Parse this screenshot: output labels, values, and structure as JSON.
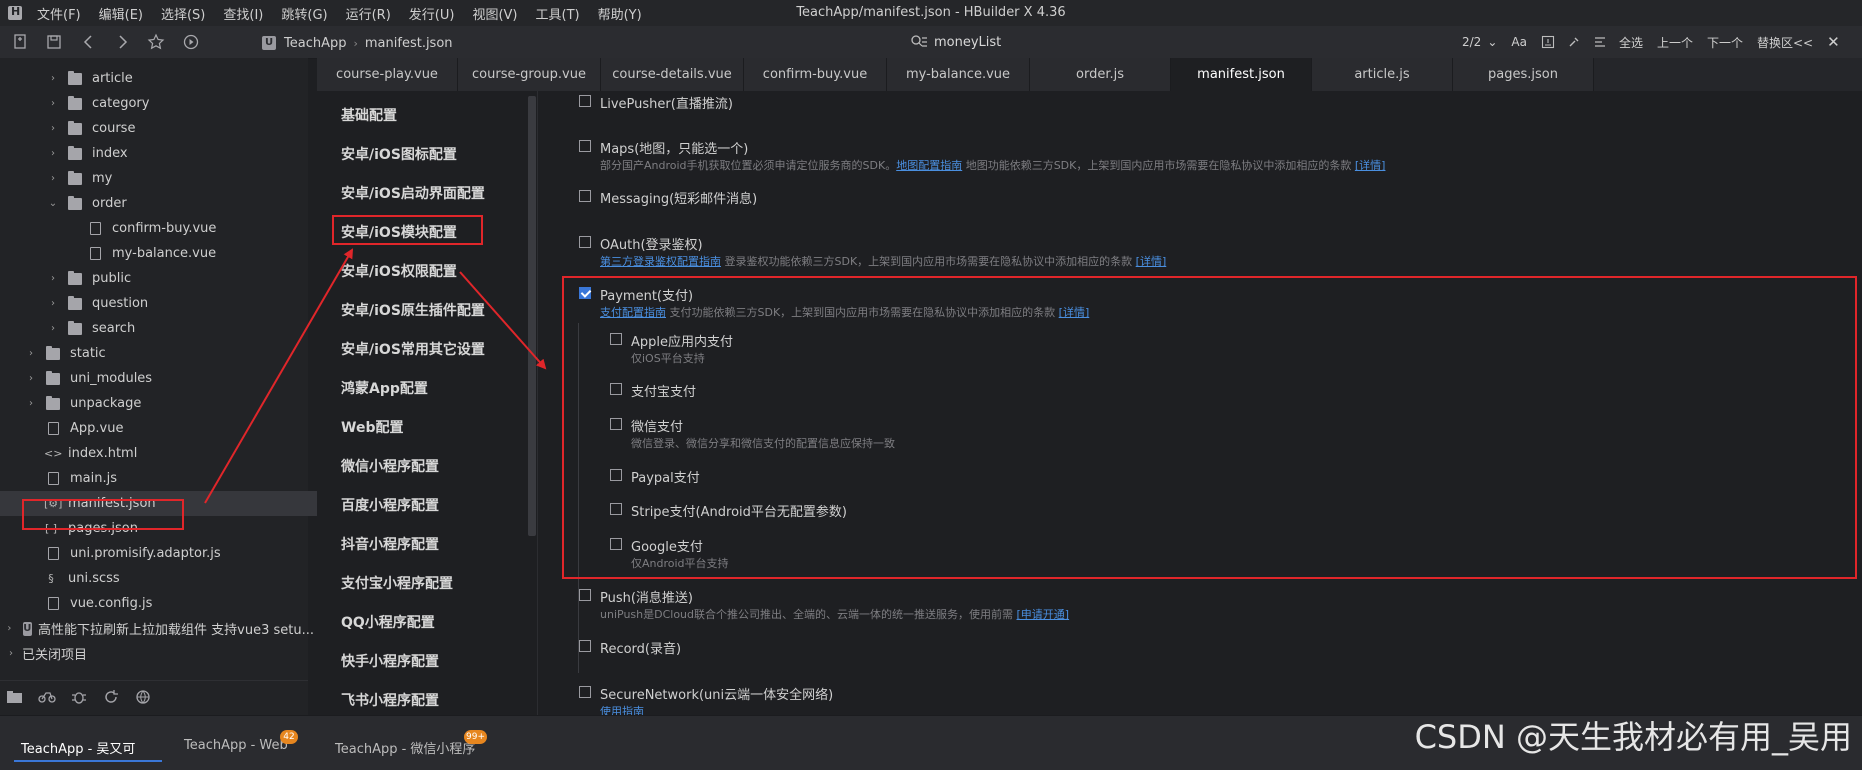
{
  "menubar": {
    "items": [
      "文件(F)",
      "编辑(E)",
      "选择(S)",
      "查找(I)",
      "跳转(G)",
      "运行(R)",
      "发行(U)",
      "视图(V)",
      "工具(T)",
      "帮助(Y)"
    ],
    "title": "TeachApp/manifest.json - HBuilder X 4.36"
  },
  "toolbar": {
    "breadcrumb": [
      "TeachApp",
      "manifest.json"
    ],
    "project_badge": "U",
    "search_value": "moneyList",
    "find": {
      "count": "2/2",
      "case_label": "Aa",
      "select_all": "全选",
      "prev": "上一个",
      "next": "下一个",
      "replace": "替换区<<"
    }
  },
  "sidebar": {
    "items": [
      {
        "label": "article",
        "kind": "folder",
        "expand": "›"
      },
      {
        "label": "category",
        "kind": "folder",
        "expand": "›"
      },
      {
        "label": "course",
        "kind": "folder",
        "expand": "›"
      },
      {
        "label": "index",
        "kind": "folder",
        "expand": "›"
      },
      {
        "label": "my",
        "kind": "folder",
        "expand": "›"
      },
      {
        "label": "order",
        "kind": "folder",
        "expand": "⌄"
      },
      {
        "label": "confirm-buy.vue",
        "kind": "vfile"
      },
      {
        "label": "my-balance.vue",
        "kind": "vfile"
      },
      {
        "label": "public",
        "kind": "folder",
        "expand": "›"
      },
      {
        "label": "question",
        "kind": "folder",
        "expand": "›"
      },
      {
        "label": "search",
        "kind": "folder",
        "expand": "›"
      },
      {
        "label": "static",
        "kind": "folder",
        "expand": "›"
      },
      {
        "label": "uni_modules",
        "kind": "folder",
        "expand": "›"
      },
      {
        "label": "unpackage",
        "kind": "folder",
        "expand": "›"
      },
      {
        "label": "App.vue",
        "kind": "vfile"
      },
      {
        "label": "index.html",
        "kind": "html",
        "glyph": "<>"
      },
      {
        "label": "main.js",
        "kind": "file"
      },
      {
        "label": "manifest.json",
        "kind": "json-settings",
        "glyph": "[⚙]"
      },
      {
        "label": "pages.json",
        "kind": "json",
        "glyph": "[ ]"
      },
      {
        "label": "uni.promisify.adaptor.js",
        "kind": "file"
      },
      {
        "label": "uni.scss",
        "kind": "scss",
        "glyph": "§"
      },
      {
        "label": "vue.config.js",
        "kind": "file"
      },
      {
        "label": "高性能下拉刷新上拉加载组件 支持vue3 setu...",
        "kind": "project",
        "expand": "›",
        "glyph": "U"
      },
      {
        "label": "已关闭项目",
        "kind": "section",
        "expand": "›"
      }
    ]
  },
  "tabs": [
    "course-play.vue",
    "course-group.vue",
    "course-details.vue",
    "confirm-buy.vue",
    "my-balance.vue",
    "order.js",
    "manifest.json",
    "article.js",
    "pages.json"
  ],
  "active_tab": "manifest.json",
  "config_nav": [
    "基础配置",
    "安卓/iOS图标配置",
    "安卓/iOS启动界面配置",
    "安卓/iOS模块配置",
    "安卓/iOS权限配置",
    "安卓/iOS原生插件配置",
    "安卓/iOS常用其它设置",
    "鸿蒙App配置",
    "Web配置",
    "微信小程序配置",
    "百度小程序配置",
    "抖音小程序配置",
    "支付宝小程序配置",
    "QQ小程序配置",
    "快手小程序配置",
    "飞书小程序配置"
  ],
  "modules": {
    "livepusher": {
      "label": "LivePusher(直播推流)",
      "checked": false
    },
    "maps": {
      "label": "Maps(地图，只能选一个)",
      "checked": false,
      "desc_pre": "部分国产Android手机获取位置必须申请定位服务商的SDK。",
      "desc_link": "地图配置指南",
      "desc_post": " 地图功能依赖三方SDK，上架到国内应用市场需要在隐私协议中添加相应的条款 ",
      "desc_more": "[详情]"
    },
    "messaging": {
      "label": "Messaging(短彩邮件消息)",
      "checked": false
    },
    "oauth": {
      "label": "OAuth(登录鉴权)",
      "checked": false,
      "desc_link": "第三方登录鉴权配置指南",
      "desc_post": " 登录鉴权功能依赖三方SDK，上架到国内应用市场需要在隐私协议中添加相应的条款 ",
      "desc_more": "[详情]"
    },
    "payment": {
      "label": "Payment(支付)",
      "checked": true,
      "desc_link": "支付配置指南",
      "desc_post": " 支付功能依赖三方SDK，上架到国内应用市场需要在隐私协议中添加相应的条款 ",
      "desc_more": "[详情]",
      "sub": [
        {
          "label": "Apple应用内支付",
          "desc": "仅iOS平台支持",
          "checked": false
        },
        {
          "label": "支付宝支付",
          "desc": "",
          "checked": false
        },
        {
          "label": "微信支付",
          "desc": "微信登录、微信分享和微信支付的配置信息应保持一致",
          "checked": false
        },
        {
          "label": "Paypal支付",
          "desc": "",
          "checked": false
        },
        {
          "label": "Stripe支付(Android平台无配置参数)",
          "desc": "",
          "checked": false
        },
        {
          "label": "Google支付",
          "desc": "仅Android平台支持",
          "checked": false
        }
      ]
    },
    "push": {
      "label": "Push(消息推送)",
      "checked": false,
      "desc_pre": "uniPush是DCloud联合个推公司推出、全端的、云端一体的统一推送服务，使用前需 ",
      "desc_more": "[申请开通]"
    },
    "record": {
      "label": "Record(录音)",
      "checked": false
    },
    "securenetwork": {
      "label": "SecureNetwork(uni云端一体安全网络)",
      "checked": false,
      "desc_link": "使用指南"
    }
  },
  "bottombar": {
    "tabs": [
      {
        "label": "TeachApp - 吴又可",
        "badge": ""
      },
      {
        "label": "TeachApp - Web",
        "badge": "42"
      },
      {
        "label": "TeachApp - 微信小程序",
        "badge": "99+"
      }
    ]
  },
  "watermark": "CSDN @天生我材必有用_吴用",
  "colors": {
    "highlight_red": "#e0262a",
    "checkbox_blue": "#3a77d8",
    "link_blue": "#4a8fe0"
  }
}
